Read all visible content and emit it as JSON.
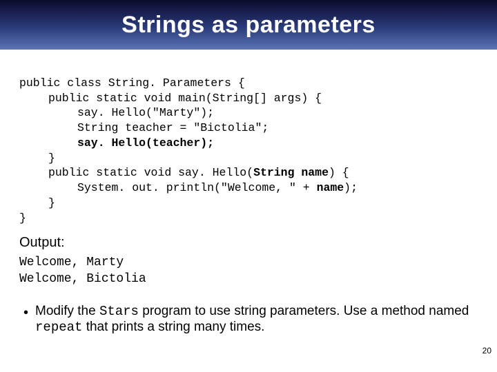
{
  "header": {
    "title": "Strings as parameters"
  },
  "code": {
    "l1": "public class String. Parameters {",
    "l2": "public static void main(String[] args) {",
    "l3": "say. Hello(\"Marty\");",
    "l4": "String teacher = \"Bictolia\";",
    "l5": "say. Hello(teacher);",
    "l6": "}",
    "l7a": "public static void say. Hello(",
    "l7b": "String name",
    "l7c": ") {",
    "l8a": "System. out. println(\"Welcome, \" + ",
    "l8b": "name",
    "l8c": ");",
    "l9": "}",
    "l10": "}"
  },
  "output": {
    "label": "Output:",
    "line1": "Welcome, Marty",
    "line2": "Welcome, Bictolia"
  },
  "bullet": {
    "dot": "•",
    "t1": "Modify the ",
    "t2": "Stars",
    "t3": " program to use string parameters. Use a method named ",
    "t4": "repeat",
    "t5": " that prints a string many times."
  },
  "page": "20"
}
